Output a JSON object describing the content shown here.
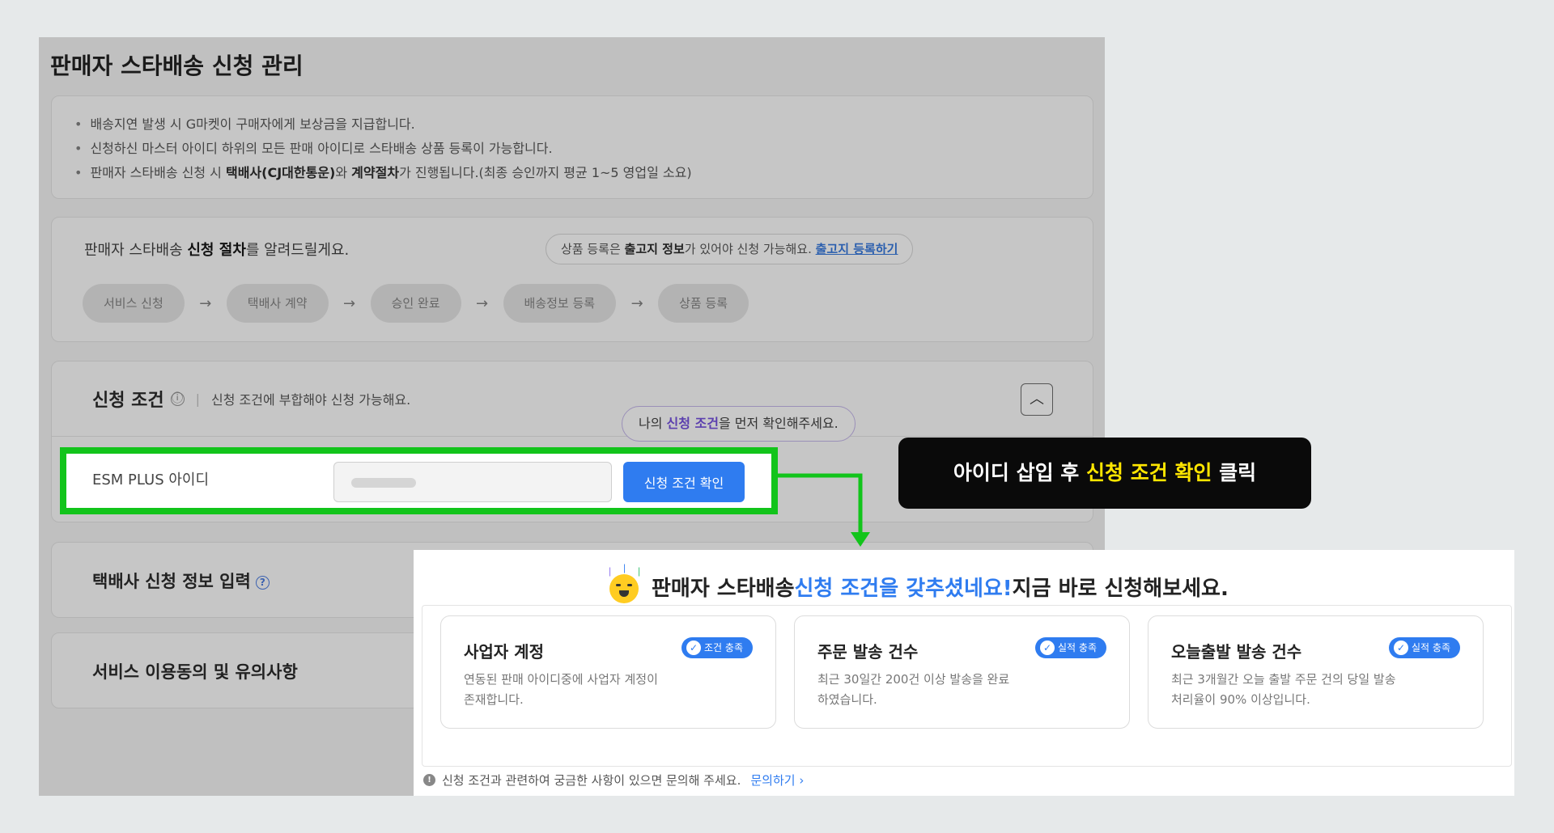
{
  "page": {
    "title": "판매자 스타배송 신청 관리"
  },
  "notice": {
    "items": [
      {
        "pre": "배송지연 발생 시 G마켓이 구매자에게 보상금을 지급합니다.",
        "b1": "",
        "mid": "",
        "b2": "",
        "post": ""
      },
      {
        "pre": "신청하신 마스터 아이디 하위의 모든 판매 아이디로 스타배송 상품 등록이 가능합니다.",
        "b1": "",
        "mid": "",
        "b2": "",
        "post": ""
      },
      {
        "pre": "판매자 스타배송 신청 시 ",
        "b1": "택배사(CJ대한통운)",
        "mid": "와 ",
        "b2": "계약절차",
        "post": "가 진행됩니다.(최종 승인까지 평균 1~5 영업일 소요)"
      }
    ]
  },
  "process": {
    "lead_pre": "판매자 스타배송 ",
    "lead_bold": "신청 절차",
    "lead_post": "를 알려드릴게요.",
    "tip_pre": "상품 등록은 ",
    "tip_bold": "출고지 정보",
    "tip_post": "가 있어야 신청 가능해요. ",
    "tip_link": "출고지 등록하기",
    "steps": [
      "서비스 신청",
      "택배사 계약",
      "승인 완료",
      "배송정보 등록",
      "상품 등록"
    ],
    "arrow": "→"
  },
  "condition": {
    "heading": "신청 조건",
    "info_icon": "ⓘ",
    "desc": "신청 조건에 부합해야 신청 가능해요.",
    "bubble_pre": "나의 ",
    "bubble_bold": "신청 조건",
    "bubble_post": "을 먼저 확인해주세요.",
    "id_label": "ESM PLUS 아이디",
    "check_button": "신청 조건 확인"
  },
  "carrier": {
    "heading": "택배사 신청 정보 입력",
    "help": "?"
  },
  "terms": {
    "heading": "서비스 이용동의 및 유의사항"
  },
  "callout": {
    "pre": "아이디 삽입 후 ",
    "highlight": "신청 조건 확인",
    "post": " 클릭"
  },
  "result": {
    "headline_pre": "판매자 스타배송 ",
    "headline_hi": "신청 조건을 갖추셨네요!",
    "headline_post": " 지금 바로 신청해보세요.",
    "cards": [
      {
        "title": "사업자 계정",
        "badge": "조건 충족",
        "desc": "연동된 판매 아이디중에 사업자 계정이 존재합니다."
      },
      {
        "title": "주문 발송 건수",
        "badge": "실적 충족",
        "desc": "최근 30일간 200건 이상 발송을 완료하였습니다."
      },
      {
        "title": "오늘출발 발송 건수",
        "badge": "실적 충족",
        "desc": "최근 3개월간 오늘 출발 주문 건의 당일 발송 처리율이 90% 이상입니다."
      }
    ],
    "footer_text": "신청 조건과 관련하여 궁금한 사항이 있으면 문의해 주세요.",
    "footer_link": "문의하기 ›"
  },
  "colors": {
    "highlight_border": "#12c41b",
    "primary": "#2f7cf0",
    "callout_accent": "#ffe600"
  }
}
